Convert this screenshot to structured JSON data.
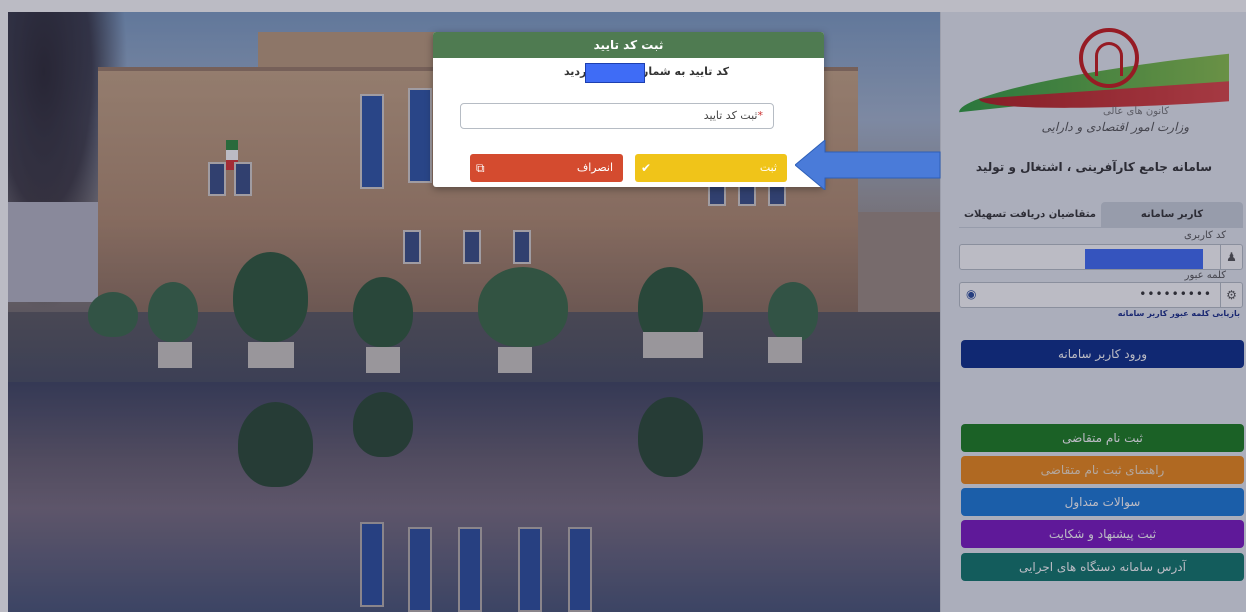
{
  "modal": {
    "title": "ثبت کد تایید",
    "message": "کد تایید به شماره   ارسال گردید",
    "input_label": "ثبت کد تایید",
    "input_required_mark": "*",
    "submit_label": "ثبت",
    "submit_icon": "check-icon",
    "cancel_label": "انصراف",
    "cancel_icon": "external-link-icon"
  },
  "logo": {
    "line1": "کانون های عالی",
    "line2": "وزارت امور اقتصادی و دارایی"
  },
  "panel": {
    "system_title": "سامانه جامع کارآفرینی ، اشتغال و تولید",
    "tabs": [
      {
        "label": "کاربر سامانه",
        "active": true
      },
      {
        "label": "متقاضیان دریافت تسهیلات",
        "active": false
      }
    ],
    "username_label": "کد کاربری",
    "password_label": "کلمه عبور",
    "password_value": "•••••••••",
    "forgot_link": "بازیابی کلمه عبور کاربر سامانه",
    "login_button": "ورود کاربر سامانه",
    "links": [
      {
        "label": "ثبت نام متقاضی",
        "color": "#1b7e1e"
      },
      {
        "label": "راهنمای ثبت نام متقاضی",
        "color": "#ef8a17"
      },
      {
        "label": "سوالات متداول",
        "color": "#1b7ad9"
      },
      {
        "label": "ثبت پیشنهاد و شکایت",
        "color": "#7b18c2"
      },
      {
        "label": "آدرس سامانه دستگاه های اجرایی",
        "color": "#0f786b"
      }
    ]
  },
  "colors": {
    "modal_header": "#4f7b51",
    "submit": "#f0c419",
    "cancel": "#d44b2f",
    "login": "#0b2d8a",
    "annotation_arrow": "#4a7bd9"
  }
}
